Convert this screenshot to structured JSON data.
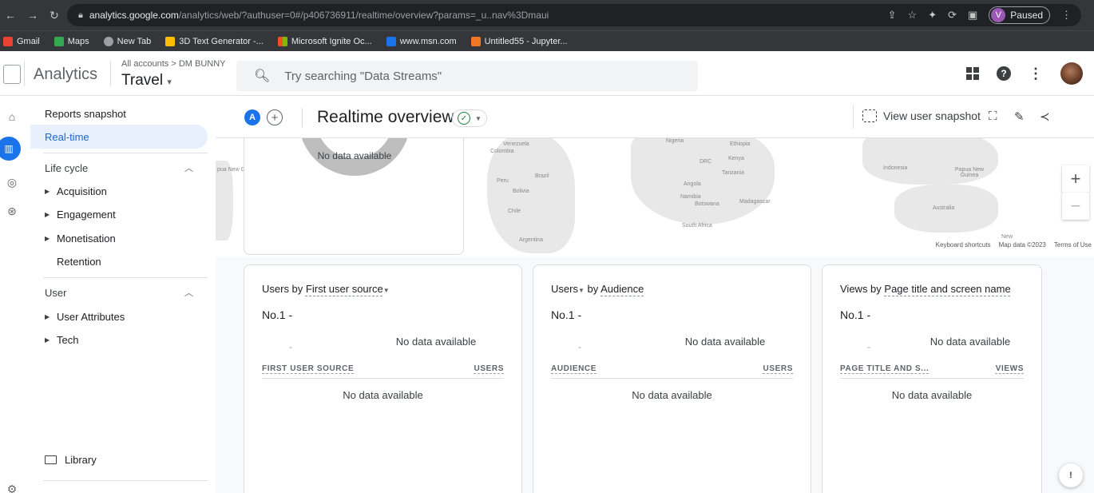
{
  "browser": {
    "url_host": "analytics.google.com",
    "url_path": "/analytics/web/?authuser=0#/p406736911/realtime/overview?params=_u..nav%3Dmaui",
    "profile_initial": "V",
    "profile_status": "Paused",
    "bookmarks": [
      {
        "label": "Gmail",
        "color": "#ea4335"
      },
      {
        "label": "Maps",
        "color": "#34a853"
      },
      {
        "label": "New Tab",
        "color": "#9aa0a6"
      },
      {
        "label": "3D Text Generator -...",
        "color": "#fbbc04"
      },
      {
        "label": "Microsoft Ignite Oc...",
        "color": "#f25022"
      },
      {
        "label": "www.msn.com",
        "color": "#1a73e8"
      },
      {
        "label": "Untitled55 - Jupyter...",
        "color": "#f37626"
      }
    ]
  },
  "header": {
    "product": "Analytics",
    "breadcrumb": "All accounts > DM BUNNY",
    "property": "Travel",
    "search_placeholder": "Try searching \"Data Streams\""
  },
  "sidebar": {
    "reports_snapshot": "Reports snapshot",
    "realtime": "Real-time",
    "lifecycle": "Life cycle",
    "lifecycle_items": [
      "Acquisition",
      "Engagement",
      "Monetisation"
    ],
    "retention": "Retention",
    "user": "User",
    "user_items": [
      "User Attributes",
      "Tech"
    ],
    "library": "Library"
  },
  "toolbar": {
    "compare_badge": "A",
    "title": "Realtime overview",
    "view_snapshot": "View user snapshot"
  },
  "map": {
    "labels": [
      "Venezuela",
      "Colombia",
      "Brazil",
      "Peru",
      "Bolivia",
      "Chile",
      "Argentina",
      "Nigeria",
      "Ethiopia",
      "DRC",
      "Kenya",
      "Tanzania",
      "Angola",
      "Namibia",
      "Botswana",
      "Madagascar",
      "South Africa",
      "Indonesia",
      "Papua New Guinea",
      "Australia",
      "New"
    ],
    "attribution": [
      "Keyboard shortcuts",
      "Map data ©2023",
      "Terms of Use"
    ],
    "left_clip_label": "pua New Guinea"
  },
  "donut_card": {
    "no_data": "No data available"
  },
  "cards": [
    {
      "title_prefix": "Users by ",
      "title_dim": "First user source",
      "rank": "No.1 -",
      "mini": "-",
      "no_data": "No data available",
      "col_left": "FIRST USER SOURCE",
      "col_right": "USERS",
      "table_no_data": "No data available"
    },
    {
      "title_prefix": "Users",
      "title_dim": "Audience",
      "title_mid": " by ",
      "rank": "No.1 -",
      "mini": "-",
      "no_data": "No data available",
      "col_left": "AUDIENCE",
      "col_right": "USERS",
      "table_no_data": "No data available"
    },
    {
      "title_prefix": "Views by ",
      "title_dim": "Page title and screen name",
      "rank": "No.1 -",
      "mini": "-",
      "no_data": "No data available",
      "col_left": "PAGE TITLE AND S...",
      "col_right": "VIEWS",
      "table_no_data": "No data available"
    }
  ]
}
